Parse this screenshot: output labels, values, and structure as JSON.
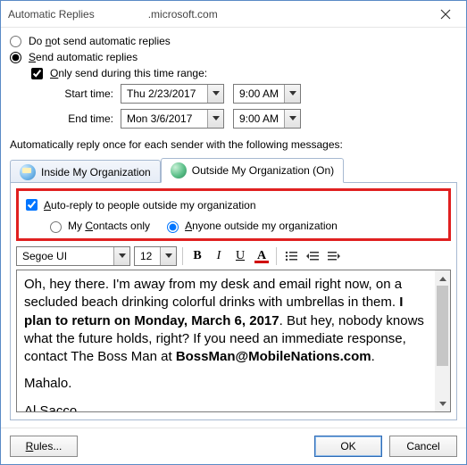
{
  "title_left": "Automatic Replies",
  "title_right": ".microsoft.com",
  "do_not_send_label_pre": "Do ",
  "do_not_send_label_u": "n",
  "do_not_send_label_post": "ot send automatic replies",
  "send_label_u": "S",
  "send_label_post": "end automatic replies",
  "only_send_u": "O",
  "only_send_post": "nly send during this time range:",
  "start_time_label": "Start time:",
  "end_time_label": "End time:",
  "start_date": "Thu 2/23/2017",
  "start_hour": "9:00 AM",
  "end_date": "Mon 3/6/2017",
  "end_hour": "9:00 AM",
  "auto_reply_msg": "Automatically reply once for each sender with the following messages:",
  "tab_inside": "Inside My Organization",
  "tab_outside": "Outside My Organization (On)",
  "auto_reply_outside_u": "A",
  "auto_reply_outside_post": "uto-reply to people outside my organization",
  "contacts_only_pre": "My ",
  "contacts_only_u": "C",
  "contacts_only_post": "ontacts only",
  "anyone_outside_u": "A",
  "anyone_outside_post": "nyone outside my organization",
  "font_name": "Segoe UI",
  "font_size": "12",
  "editor_html": "Oh, hey there. I'm away from my desk and email right now, on a secluded beach drinking colorful drinks with umbrellas in them. <b>I plan to return on Monday, March 6, 2017</b>. But hey, nobody knows what the future holds, right? If you need an immediate response, contact The Boss Man at <b>BossMan@MobileNations.com</b>.",
  "editor_line2": "Mahalo.",
  "editor_line3": "Al Sacco",
  "rules_btn_u": "R",
  "rules_btn_post": "ules...",
  "ok_btn": "OK",
  "cancel_btn": "Cancel"
}
